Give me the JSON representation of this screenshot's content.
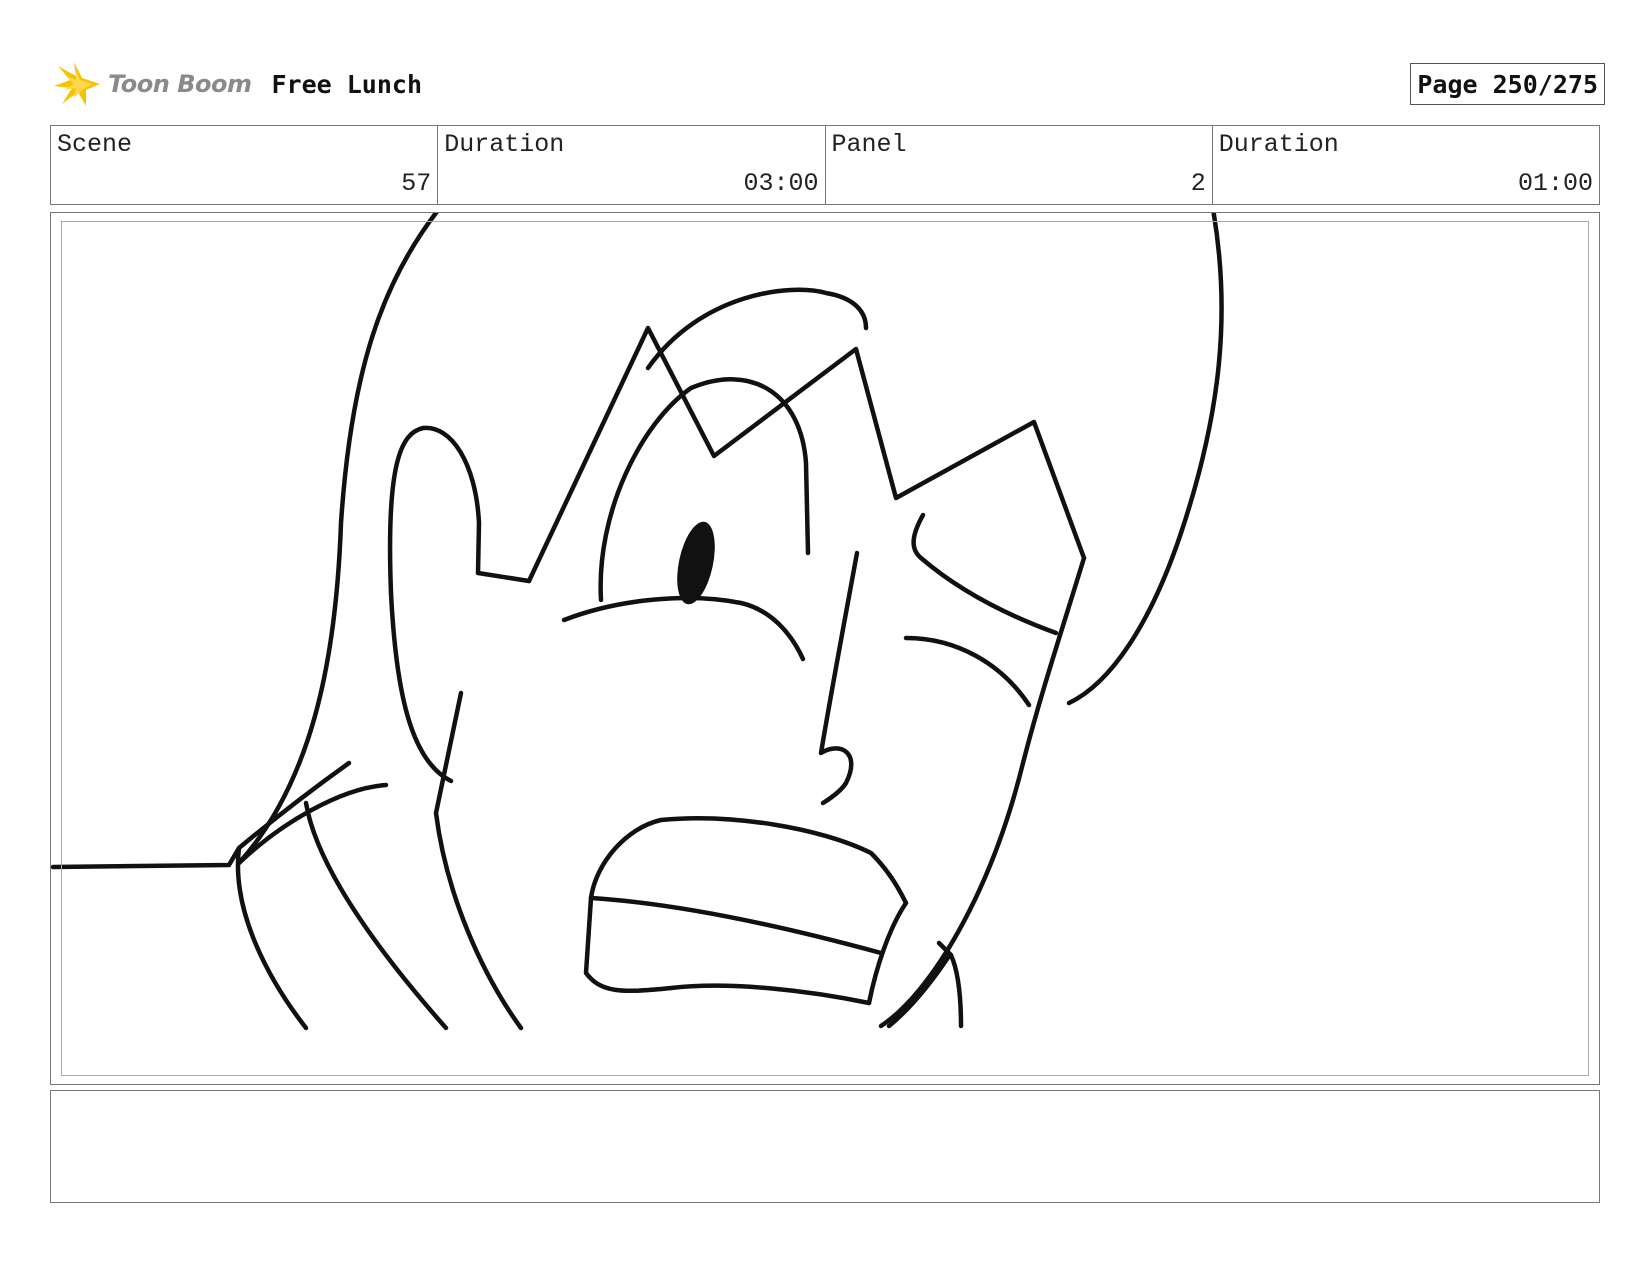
{
  "header": {
    "logo_text": "Toon Boom",
    "project_title": "Free Lunch",
    "page": "Page 250/275"
  },
  "info": {
    "scene_label": "Scene",
    "scene_value": "57",
    "scene_duration_label": "Duration",
    "scene_duration_value": "03:00",
    "panel_label": "Panel",
    "panel_value": "2",
    "panel_duration_label": "Duration",
    "panel_duration_value": "01:00"
  },
  "colors": {
    "logo_accent": "#f5c400",
    "logo_text": "#8a8a8a",
    "line": "#111111",
    "border": "#777777"
  },
  "notes": {
    "text": ""
  }
}
